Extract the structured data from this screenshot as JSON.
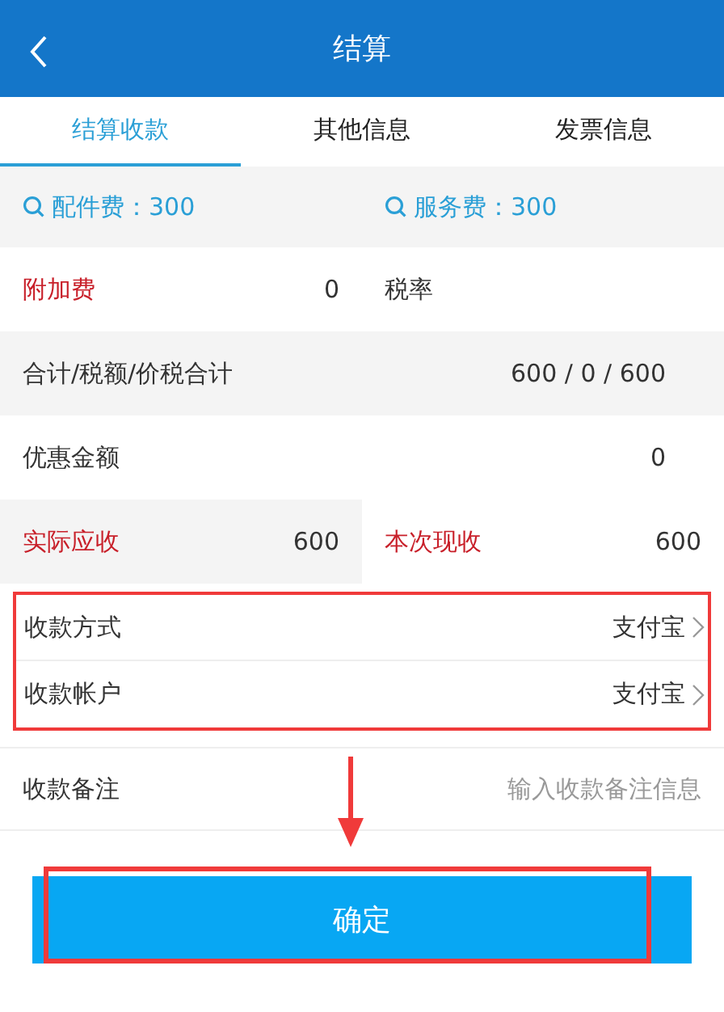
{
  "header": {
    "title": "结算"
  },
  "tabs": [
    {
      "label": "结算收款",
      "selected": true
    },
    {
      "label": "其他信息",
      "selected": false
    },
    {
      "label": "发票信息",
      "selected": false
    }
  ],
  "fees": [
    {
      "label": "配件费：300"
    },
    {
      "label": "服务费：300"
    }
  ],
  "rows": [
    {
      "kind": "split",
      "cells": [
        {
          "label": "附加费",
          "highlight": true,
          "value": "0"
        },
        {
          "label": "税率",
          "highlight": false
        }
      ]
    },
    {
      "kind": "full",
      "label": "合计/税额/价税合计",
      "value": "600 / 0 / 600"
    },
    {
      "kind": "full",
      "label": "优惠金额",
      "value": "0"
    },
    {
      "kind": "split",
      "cells": [
        {
          "label": "实际应收",
          "highlight": true,
          "value": "600"
        },
        {
          "label": "本次现收",
          "highlight": true,
          "value": "600"
        }
      ]
    }
  ],
  "payment": [
    {
      "label": "收款方式",
      "value": "支付宝"
    },
    {
      "label": "收款帐户",
      "value": "支付宝"
    }
  ],
  "note": {
    "label": "收款备注",
    "placeholder": "输入收款备注信息"
  },
  "confirm_button": "确定"
}
